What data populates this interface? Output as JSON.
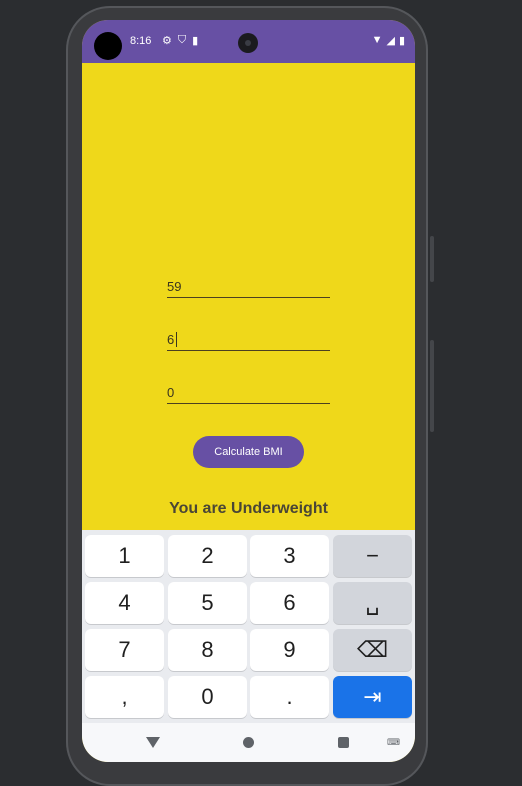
{
  "status_bar": {
    "time": "8:16",
    "left_icons": [
      "gear-icon",
      "shield-icon",
      "sd-card-icon"
    ],
    "right_icons": [
      "wifi-icon",
      "signal-icon",
      "battery-icon"
    ]
  },
  "form": {
    "weight_value": "59",
    "height_value": "6",
    "third_value": "0",
    "button_label": "Calculate BMI"
  },
  "result_text": "You are Underweight",
  "keyboard": {
    "rows": [
      [
        "1",
        "2",
        "3",
        "−"
      ],
      [
        "4",
        "5",
        "6",
        "␣"
      ],
      [
        "7",
        "8",
        "9",
        "⌫"
      ],
      [
        ",",
        "0",
        ".",
        "⇥"
      ]
    ]
  },
  "nav": {
    "icons": [
      "back-icon",
      "home-icon",
      "recents-icon",
      "keyboard-switch-icon"
    ]
  },
  "colors": {
    "app_background": "#efd81a",
    "accent": "#6750a4",
    "action_key": "#1a73e8"
  }
}
